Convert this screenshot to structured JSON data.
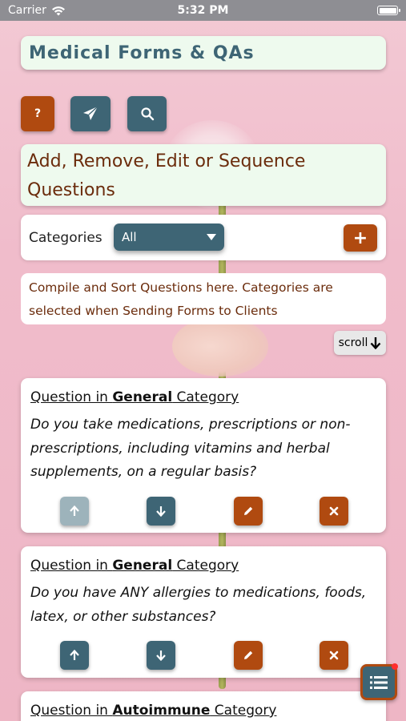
{
  "status_bar": {
    "carrier": "Carrier",
    "time": "5:32 PM",
    "battery_level": 1.0
  },
  "app": {
    "title": "Medical Forms & QAs"
  },
  "toolbar": {
    "help_label": "?",
    "send_icon": "paper-plane-icon",
    "search_icon": "search-icon"
  },
  "section": {
    "header": "Add, Remove, Edit or Sequence Questions"
  },
  "categories": {
    "label": "Categories",
    "selected": "All",
    "add_label": "+"
  },
  "info": {
    "text": "Compile and Sort Questions here. Categories are selected when Sending Forms to Clients"
  },
  "scroll": {
    "label": "scroll",
    "arrow": "🡫"
  },
  "cards": [
    {
      "prefix": "Question in ",
      "category": "General",
      "suffix": " Category",
      "question": "Do you take medications, prescriptions or non-prescriptions, including vitamins and herbal supplements, on a regular basis?",
      "up_enabled": false
    },
    {
      "prefix": "Question in ",
      "category": "General",
      "suffix": " Category",
      "question": "Do you have ANY allergies to medications, foods, latex, or other substances?",
      "up_enabled": true
    },
    {
      "prefix": "Question in ",
      "category": "Autoimmune",
      "suffix": " Category"
    }
  ],
  "colors": {
    "primary_teal": "#3e6575",
    "accent_orange": "#b04a10",
    "panel_green": "#eefaee",
    "text_brown": "#6b2c0c"
  }
}
